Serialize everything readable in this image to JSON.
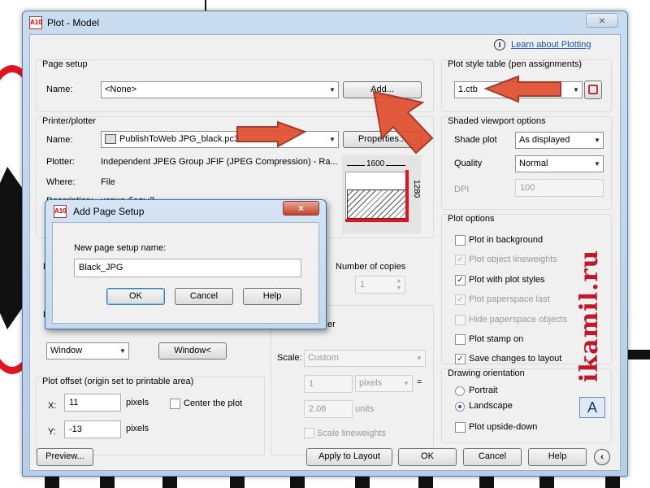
{
  "window": {
    "title": "Plot - Model",
    "app_badge": "A10"
  },
  "help_link": "Learn about Plotting",
  "page_setup": {
    "group": "Page setup",
    "name_label": "Name:",
    "name_value": "<None>",
    "add_button": "Add..."
  },
  "printer": {
    "group": "Printer/plotter",
    "name_label": "Name:",
    "name_value": "PublishToWeb JPG_black.pc3",
    "properties_button": "Properties...",
    "plotter_label": "Plotter:",
    "plotter_value": "Independent JPEG Group JFIF (JPEG Compression) - Ra...",
    "where_label": "Where:",
    "where_value": "File",
    "description_label": "Description:",
    "description_value": "черно-белый"
  },
  "preview": {
    "width_label": "1600",
    "height_label": "1280"
  },
  "copies": {
    "label": "Number of copies",
    "value": "1"
  },
  "plot_area": {
    "what_value": "Window",
    "window_button": "Window<"
  },
  "plot_offset": {
    "group": "Plot offset (origin set to printable area)",
    "x_label": "X:",
    "x_value": "11",
    "x_unit": "pixels",
    "y_label": "Y:",
    "y_value": "-13",
    "y_unit": "pixels",
    "center_label": "Center the plot"
  },
  "plot_scale": {
    "group_tail": "er",
    "scale_label": "Scale:",
    "scale_value": "Custom",
    "value1": "1",
    "unit1": "pixels",
    "equals": "=",
    "value2": "2.08",
    "unit2": "units",
    "lineweights_label": "Scale lineweights"
  },
  "plot_style_table": {
    "group": "Plot style table (pen assignments)",
    "value": "1.ctb"
  },
  "shaded": {
    "group": "Shaded viewport options",
    "shade_label": "Shade plot",
    "shade_value": "As displayed",
    "quality_label": "Quality",
    "quality_value": "Normal",
    "dpi_label": "DPI",
    "dpi_value": "100"
  },
  "plot_options": {
    "group": "Plot options",
    "items": [
      {
        "label": "Plot in background",
        "checked": false,
        "disabled": false
      },
      {
        "label": "Plot object lineweights",
        "checked": true,
        "disabled": true
      },
      {
        "label": "Plot with plot styles",
        "checked": true,
        "disabled": false
      },
      {
        "label": "Plot paperspace last",
        "checked": true,
        "disabled": true
      },
      {
        "label": "Hide paperspace objects",
        "checked": false,
        "disabled": true
      },
      {
        "label": "Plot stamp on",
        "checked": false,
        "disabled": false
      },
      {
        "label": "Save changes to layout",
        "checked": true,
        "disabled": false
      }
    ]
  },
  "orientation": {
    "group": "Drawing orientation",
    "portrait": "Portrait",
    "landscape": "Landscape",
    "selected": "Landscape",
    "upside_down": "Plot upside-down",
    "icon_letter": "A"
  },
  "footer": {
    "preview": "Preview...",
    "apply": "Apply to Layout",
    "ok": "OK",
    "cancel": "Cancel",
    "help": "Help"
  },
  "dialog": {
    "title": "Add Page Setup",
    "badge": "A10",
    "prompt": "New page setup name:",
    "input_value": "Black_JPG",
    "ok": "OK",
    "cancel": "Cancel",
    "help": "Help"
  },
  "watermark": "ikamil.ru",
  "colors": {
    "arrow": "#e04a2a",
    "watermark": "#c0182a",
    "title_bar": "#c9dcf0"
  }
}
